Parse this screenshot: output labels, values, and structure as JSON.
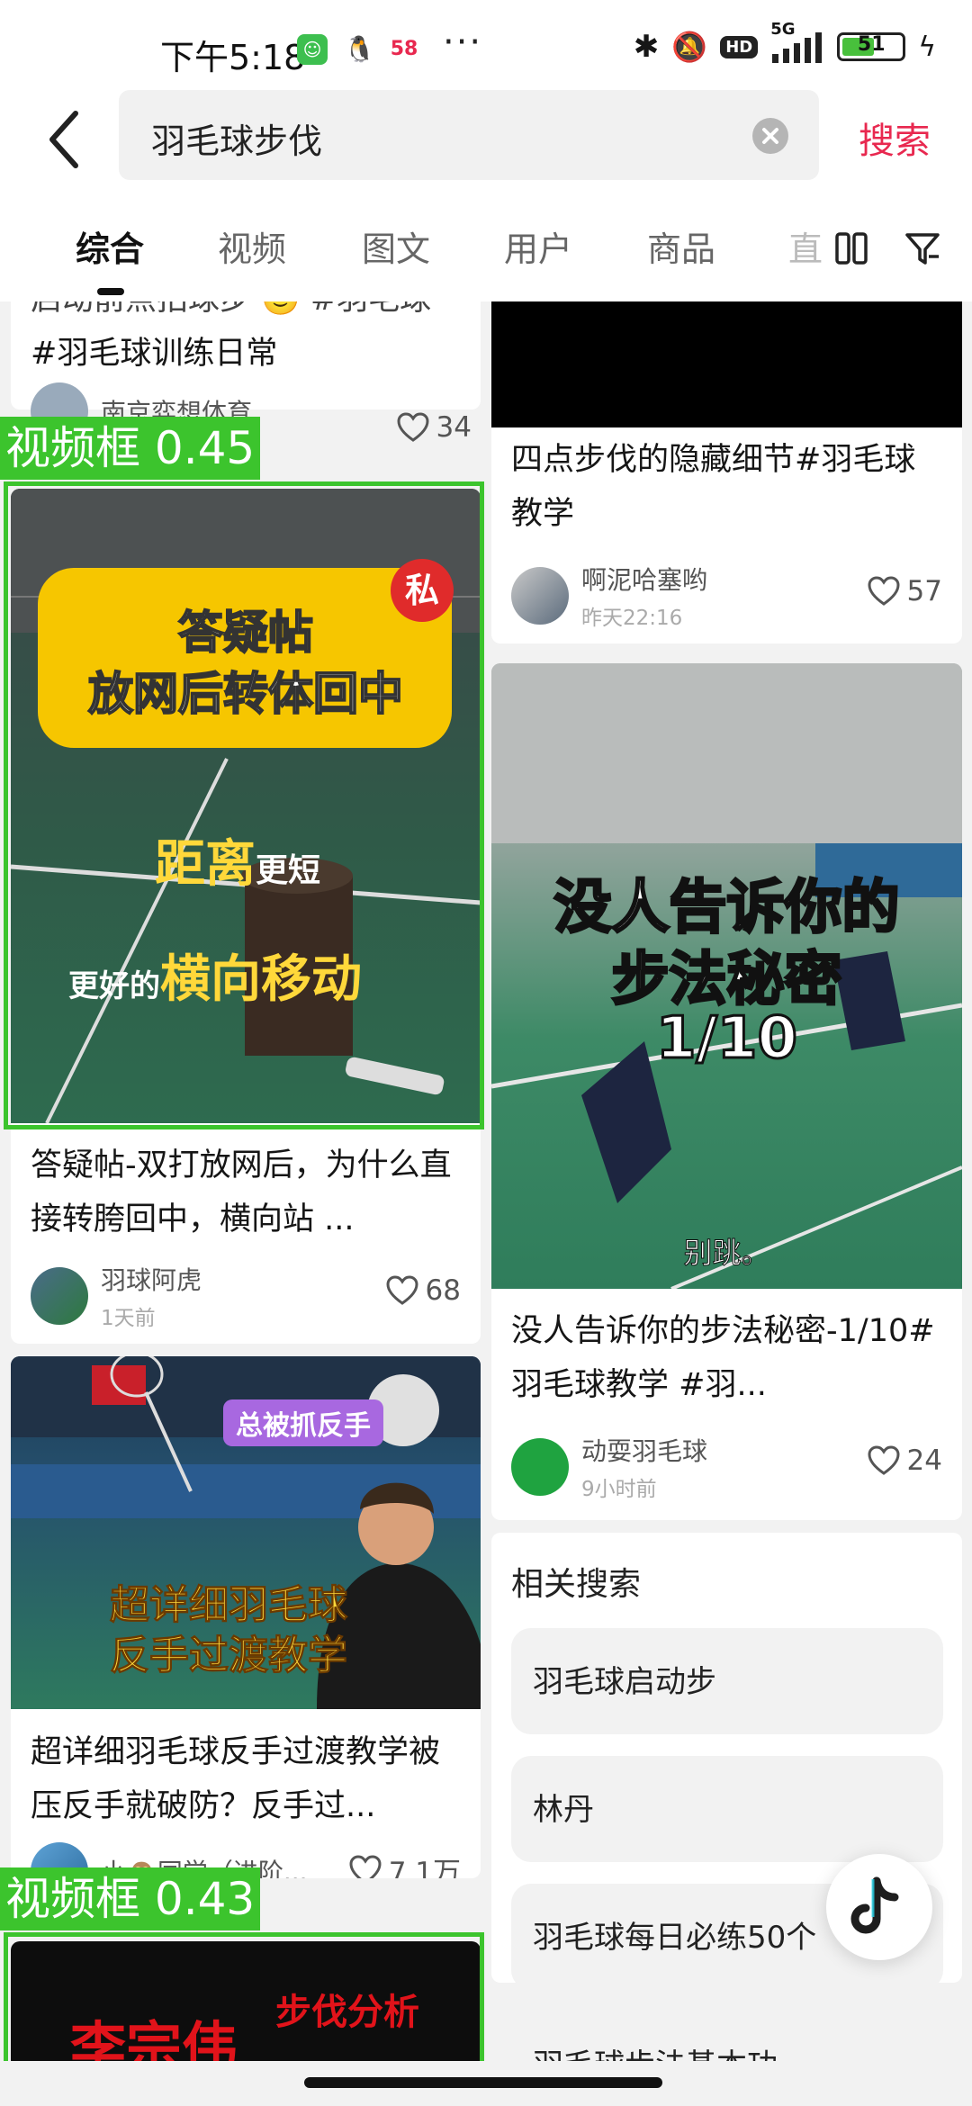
{
  "status_bar": {
    "time": "下午5:18",
    "battery": "51",
    "hd": "HD",
    "net": "5G",
    "dots": "···",
    "app_58": "58"
  },
  "search": {
    "query": "羽毛球步伐",
    "button": "搜索"
  },
  "tabs": [
    "综合",
    "视频",
    "图文",
    "用户",
    "商品"
  ],
  "tab_partial": "直",
  "left": {
    "card0": {
      "title_top": "启动前点拍球步 🙂 #羽毛球",
      "title_line2": "#羽毛球训练日常",
      "user": "南京弈想体育",
      "likes": "34"
    },
    "card1": {
      "thumb_badge": "私",
      "thumb_line1": "答疑帖",
      "thumb_line2": "放网后转体回中",
      "thumb_line3_a": "距离",
      "thumb_line3_b": "更短",
      "thumb_line4_a": "更好的",
      "thumb_line4_b": "横向移动",
      "title": "答疑帖-双打放网后，为什么直接转胯回中，横向站 ...",
      "user": "羽球阿虎",
      "time": "1天前",
      "likes": "68"
    },
    "card2": {
      "thumb_tag": "总被抓反手",
      "thumb_line1": "超详细羽毛球",
      "thumb_line2": "反手过渡教学",
      "title": "超详细羽毛球反手过渡教学被压反手就破防？反手过...",
      "user": "小🙈同学（进阶...",
      "likes": "7.1万"
    },
    "card3": {
      "thumb_a": "李宗伟",
      "thumb_b": "步伐分析"
    }
  },
  "right": {
    "card0": {
      "title": "四点步伐的隐藏细节#羽毛球教学",
      "user": "啊泥哈塞哟",
      "time": "昨天22:16",
      "likes": "57"
    },
    "card1": {
      "thumb_line1": "没人告诉你的",
      "thumb_line2": "步法秘密",
      "thumb_line3": "1/10",
      "thumb_sub": "别跳。",
      "title": "没人告诉你的步法秘密-1/10#羽毛球教学 #羽...",
      "user": "动耍羽毛球",
      "time": "9小时前",
      "likes": "24"
    }
  },
  "related": {
    "title": "相关搜索",
    "items": [
      "羽毛球启动步",
      "林丹",
      "羽毛球每日必练50个",
      "羽毛球步法基本功"
    ]
  },
  "detections": [
    {
      "label": "视频框 0.45"
    },
    {
      "label": "视频框 0.43"
    }
  ],
  "colors": {
    "accent": "#e8284f",
    "detect": "#3cc42d"
  }
}
